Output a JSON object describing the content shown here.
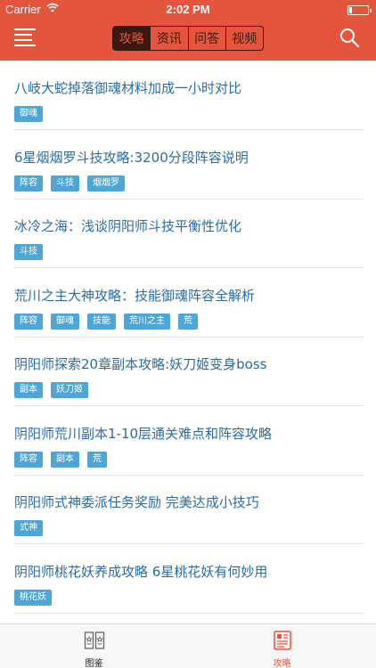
{
  "status_bar": {
    "carrier": "Carrier",
    "time": "2:02 PM"
  },
  "header": {
    "menu_icon": "hamburger-menu-icon",
    "search_icon": "search-icon",
    "tabs": [
      {
        "label": "攻略",
        "active": true
      },
      {
        "label": "资讯",
        "active": false
      },
      {
        "label": "问答",
        "active": false
      },
      {
        "label": "视频",
        "active": false
      }
    ]
  },
  "articles": [
    {
      "title": "八岐大蛇掉落御魂材料加成一小时对比",
      "tags": [
        "御魂"
      ]
    },
    {
      "title": "6星烟烟罗斗技攻略:3200分段阵容说明",
      "tags": [
        "阵容",
        "斗技",
        "烟烟罗"
      ]
    },
    {
      "title": "冰冷之海：浅谈阴阳师斗技平衡性优化",
      "tags": [
        "斗技"
      ]
    },
    {
      "title": "荒川之主大神攻略：技能御魂阵容全解析",
      "tags": [
        "阵容",
        "御魂",
        "技能",
        "荒川之主",
        "荒"
      ]
    },
    {
      "title": "阴阳师探索20章副本攻略:妖刀姬变身boss",
      "tags": [
        "副本",
        "妖刀姬"
      ]
    },
    {
      "title": "阴阳师荒川副本1-10层通关难点和阵容攻略",
      "tags": [
        "阵容",
        "副本",
        "荒"
      ]
    },
    {
      "title": "阴阳师式神委派任务奖励 完美达成小技巧",
      "tags": [
        "式神"
      ]
    },
    {
      "title": "阴阳师桃花妖养成攻略 6星桃花妖有何妙用",
      "tags": [
        "桃花妖"
      ]
    }
  ],
  "tabbar": {
    "items": [
      {
        "label": "图鉴",
        "icon": "cards-icon",
        "active": false
      },
      {
        "label": "攻略",
        "icon": "newspaper-icon",
        "active": true
      }
    ]
  },
  "colors": {
    "header_bg": "#e5553e",
    "tab_active_bg": "#3a1a10",
    "title_text": "#2b6ca3",
    "tag_bg": "#4ea6d6",
    "tabbar_active": "#e5553e"
  }
}
